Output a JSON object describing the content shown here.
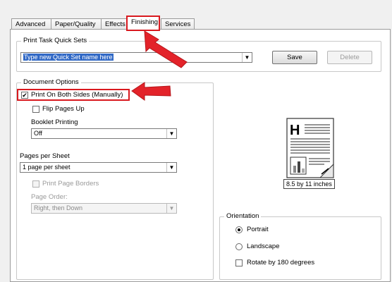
{
  "tabs": [
    {
      "label": "Advanced"
    },
    {
      "label": "Paper/Quality"
    },
    {
      "label": "Effects"
    },
    {
      "label": "Finishing"
    },
    {
      "label": "Services"
    }
  ],
  "quick_sets": {
    "legend": "Print Task Quick Sets",
    "value": "Type new Quick Set name here",
    "save_label": "Save",
    "delete_label": "Delete"
  },
  "document_options": {
    "legend": "Document Options",
    "print_both_sides": {
      "label": "Print On Both Sides (Manually)",
      "checked": true
    },
    "flip_pages_up": {
      "label": "Flip Pages Up",
      "checked": false
    },
    "booklet_printing": {
      "label": "Booklet Printing",
      "value": "Off"
    },
    "pages_per_sheet": {
      "label": "Pages per Sheet",
      "value": "1 page per sheet"
    },
    "print_page_borders": {
      "label": "Print Page Borders",
      "checked": false
    },
    "page_order": {
      "label": "Page Order:",
      "value": "Right, then Down"
    }
  },
  "preview": {
    "paper_size": "8.5 by 11 inches"
  },
  "orientation": {
    "legend": "Orientation",
    "portrait": "Portrait",
    "landscape": "Landscape",
    "rotate": "Rotate by 180 degrees",
    "selected": "portrait"
  },
  "colors": {
    "annotation": "#d9191f",
    "selection": "#3169c6"
  }
}
